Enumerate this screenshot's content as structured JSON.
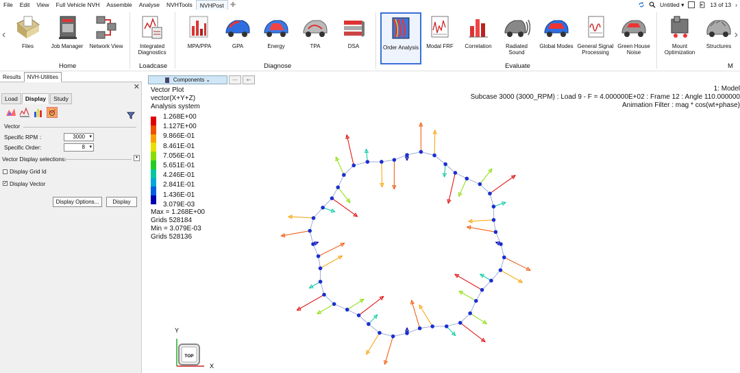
{
  "menubar": {
    "items": [
      "File",
      "Edit",
      "View",
      "Full Vehicle NVH",
      "Assemble",
      "Analyse",
      "NVHTools",
      "NVHPost"
    ],
    "active": "NVHPost",
    "right": {
      "doc_name": "Untitled",
      "page": "13 of 13"
    }
  },
  "ribbon": {
    "tools": [
      {
        "label": "Files",
        "icon": "files-icon"
      },
      {
        "label": "Job Manager",
        "icon": "job-manager-icon"
      },
      {
        "label": "Network View",
        "icon": "network-view-icon"
      },
      {
        "label": "Integrated Diagnostics",
        "icon": "integrated-diagnostics-icon"
      },
      {
        "label": "MPA/PPA",
        "icon": "mpa-ppa-icon"
      },
      {
        "label": "GPA",
        "icon": "gpa-icon"
      },
      {
        "label": "Energy",
        "icon": "energy-icon"
      },
      {
        "label": "TPA",
        "icon": "tpa-icon"
      },
      {
        "label": "DSA",
        "icon": "dsa-icon"
      },
      {
        "label": "Order Analysis",
        "icon": "order-analysis-icon"
      },
      {
        "label": "Modal FRF",
        "icon": "modal-frf-icon"
      },
      {
        "label": "Correlation",
        "icon": "correlation-icon"
      },
      {
        "label": "Radiated Sound",
        "icon": "radiated-sound-icon"
      },
      {
        "label": "Global Modes",
        "icon": "global-modes-icon"
      },
      {
        "label": "General Signal Processing",
        "icon": "signal-processing-icon"
      },
      {
        "label": "Green House Noise",
        "icon": "green-house-noise-icon"
      },
      {
        "label": "Mount Optimization",
        "icon": "mount-optimization-icon"
      },
      {
        "label": "Structures",
        "icon": "structures-icon"
      }
    ],
    "groups": [
      "Home",
      "Loadcase",
      "Diagnose",
      "Evaluate",
      "M"
    ],
    "selected_tool": "Order Analysis"
  },
  "panel_tabs": [
    "Results",
    "NVH-Utilities"
  ],
  "active_panel_tab": "NVH-Utilities",
  "utility_tabs": [
    "Load",
    "Display",
    "Study"
  ],
  "active_utility_tab": "Display",
  "display": {
    "section_vector": "Vector",
    "specific_rpm_label": "Specific RPM",
    "specific_rpm_value": "3000",
    "specific_order_label": "Specific Order",
    "specific_order_value": "8",
    "vector_display_label": "Vector Display selections:",
    "display_grid_id_label": "Display Grid Id",
    "display_grid_id_checked": false,
    "display_vector_label": "Display Vector",
    "display_vector_checked": true,
    "display_options_button": "Display Options...",
    "display_button": "Display"
  },
  "viewport": {
    "components_label": "Components",
    "more_label": "···",
    "legend": {
      "title_lines": [
        "Vector Plot",
        "vector(X+Y+Z)",
        "Analysis system"
      ],
      "values": [
        "1.268E+00",
        "1.127E+00",
        "9.866E-01",
        "8.461E-01",
        "7.056E-01",
        "5.651E-01",
        "4.246E-01",
        "2.841E-01",
        "1.436E-01",
        "3.079E-03"
      ],
      "colors": [
        "#e00000",
        "#f05000",
        "#f8a000",
        "#e8e000",
        "#88dd00",
        "#22cc22",
        "#00c8a0",
        "#00a8d8",
        "#0060e0",
        "#0000b0"
      ],
      "footer": [
        "Max =  1.268E+00",
        "Grids 528184",
        "Min =  3.079E-03",
        "Grids 528136"
      ]
    },
    "info_lines": [
      "1: Model",
      "Subcase 3000 (3000_RPM) : Load 9 - F = 4.000000E+02 : Frame 12 : Angle 110.000000",
      "Animation Filter : mag * cos(wt+phase)"
    ],
    "triad": {
      "y_label": "Y",
      "x_label": "X",
      "cube_label": "TOP"
    }
  }
}
